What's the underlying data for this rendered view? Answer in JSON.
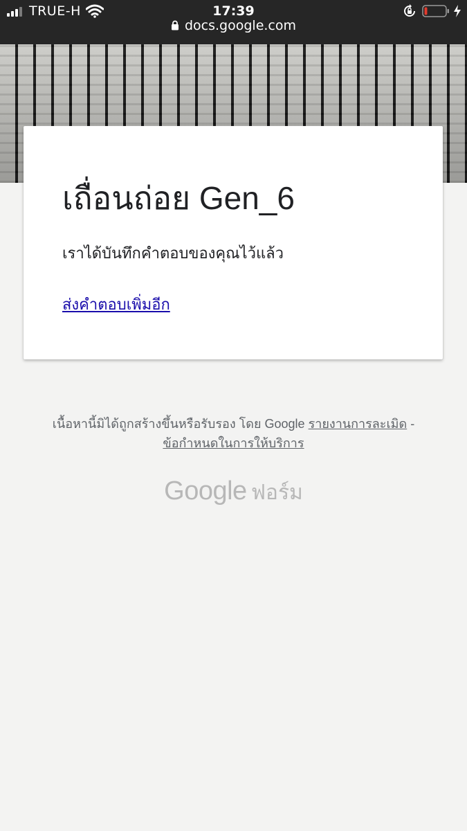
{
  "status_bar": {
    "carrier": "TRUE-H",
    "time": "17:39",
    "url": "docs.google.com"
  },
  "form": {
    "title": "เถื่อนถ่อย Gen_6",
    "confirmation": "เราได้บันทึกคำตอบของคุณไว้แล้ว",
    "submit_another_link": "ส่งคำตอบเพิ่มอีก"
  },
  "footer": {
    "disclaimer": "เนื้อหานี้มิได้ถูกสร้างขึ้นหรือรับรอง โดย Google",
    "report_abuse": "รายงานการละเมิด",
    "separator": "-",
    "terms": "ข้อกำหนดในการให้บริการ"
  },
  "logo": {
    "google": "Google",
    "product": "ฟอร์ม"
  },
  "icons": [
    "signal-icon",
    "wifi-icon",
    "padlock-icon",
    "rotation-lock-icon",
    "battery-icon",
    "charging-icon"
  ],
  "colors": {
    "status_bar_bg": "#262626",
    "page_bg": "#f3f3f2",
    "link": "#1a0dab",
    "footer_text": "#5f6368",
    "logo": "#b7b7b7",
    "battery_low": "#e23b2e"
  }
}
